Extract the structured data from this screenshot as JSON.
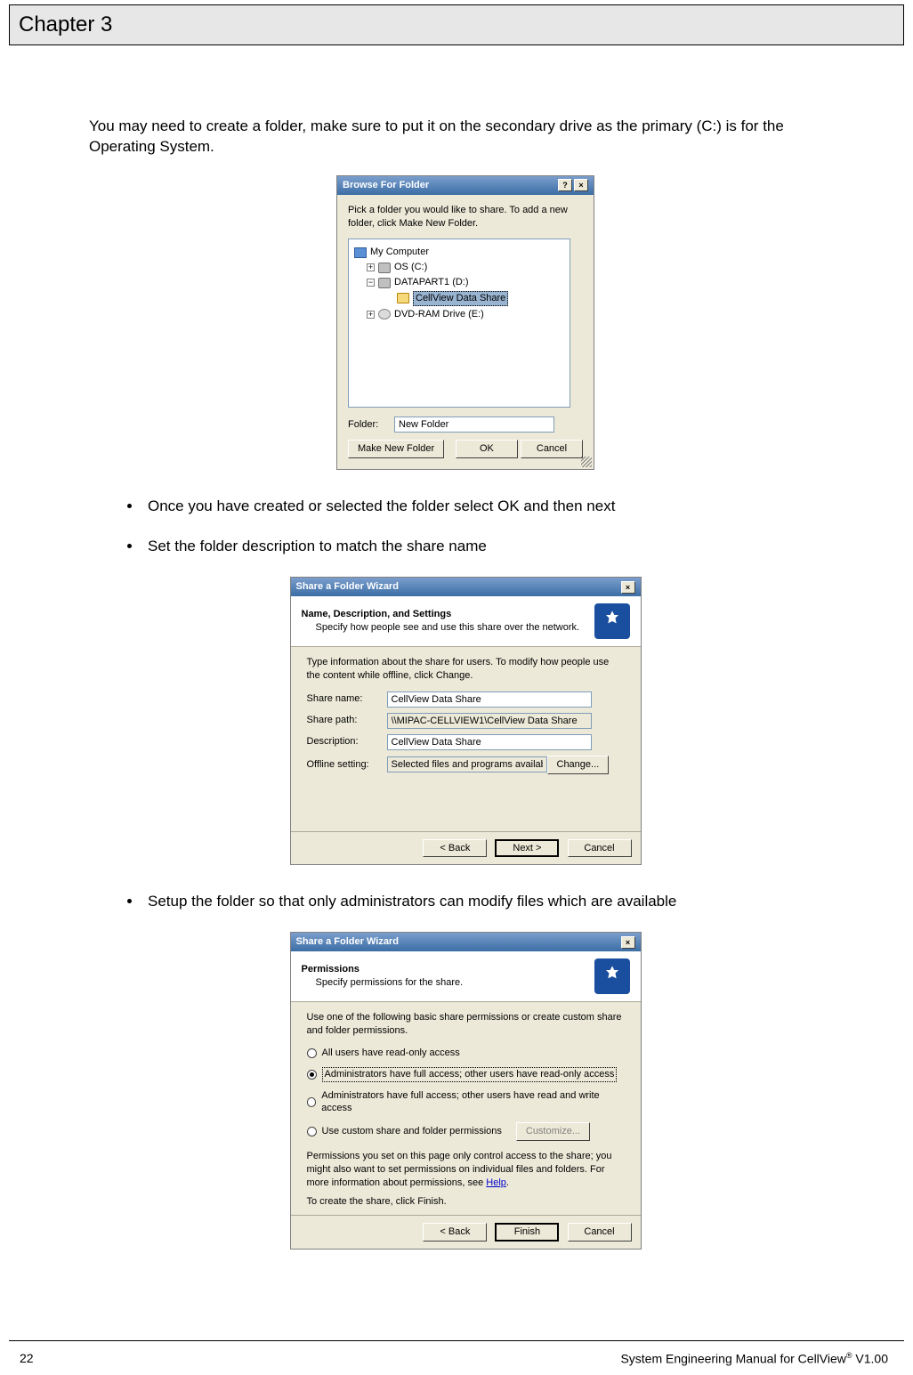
{
  "header": {
    "chapter": "Chapter 3"
  },
  "intro": "You may need to create a folder, make sure to put it on the secondary drive as the primary (C:) is for the Operating System.",
  "bullets": {
    "b1": "Once you have created or selected the folder select OK and then next",
    "b2": "Set the folder description to match the share name",
    "b3": "Setup the folder so that only administrators can modify files which are available"
  },
  "dialog_browse": {
    "title": "Browse For Folder",
    "help_glyph": "?",
    "close_glyph": "×",
    "instruction": "Pick a folder you would like to share. To add a new folder, click Make New Folder.",
    "tree": {
      "root": "My Computer",
      "drive_c": "OS (C:)",
      "drive_d": "DATAPART1 (D:)",
      "folder_sel": "CellView Data Share",
      "drive_e": "DVD-RAM Drive (E:)",
      "plus": "+",
      "minus": "−"
    },
    "folder_label": "Folder:",
    "folder_value": "New Folder",
    "btn_make": "Make New Folder",
    "btn_ok": "OK",
    "btn_cancel": "Cancel"
  },
  "dialog_wiz1": {
    "title": "Share a Folder Wizard",
    "close_glyph": "×",
    "heading": "Name, Description, and Settings",
    "subheading": "Specify how people see and use this share over the network.",
    "desc": "Type information about the share for users. To modify how people use the content while offline, click Change.",
    "lbl_sharename": "Share name:",
    "val_sharename": "CellView Data Share",
    "lbl_sharepath": "Share path:",
    "val_sharepath": "\\\\MIPAC-CELLVIEW1\\CellView Data Share",
    "lbl_description": "Description:",
    "val_description": "CellView Data Share",
    "lbl_offline": "Offline setting:",
    "val_offline": "Selected files and programs available offline",
    "btn_change": "Change...",
    "btn_back": "< Back",
    "btn_next": "Next >",
    "btn_cancel": "Cancel"
  },
  "dialog_wiz2": {
    "title": "Share a Folder Wizard",
    "close_glyph": "×",
    "heading": "Permissions",
    "subheading": "Specify permissions for the share.",
    "desc": "Use one of the following basic share permissions or create custom share and folder permissions.",
    "opt1": "All users have read-only access",
    "opt2": "Administrators have full access; other users have read-only access",
    "opt3": "Administrators have full access; other users have read and write access",
    "opt4": "Use custom share and folder permissions",
    "btn_customize": "Customize...",
    "note_pre": "Permissions you set on this page only control access to the share; you might also want to set permissions on individual files and folders. For more information about permissions, see ",
    "note_link": "Help",
    "note_post": ".",
    "create_text": "To create the share, click Finish.",
    "btn_back": "< Back",
    "btn_finish": "Finish",
    "btn_cancel": "Cancel"
  },
  "footer": {
    "page": "22",
    "manual_pre": "System Engineering Manual for CellView",
    "reg": "®",
    "manual_post": " V1.00"
  }
}
